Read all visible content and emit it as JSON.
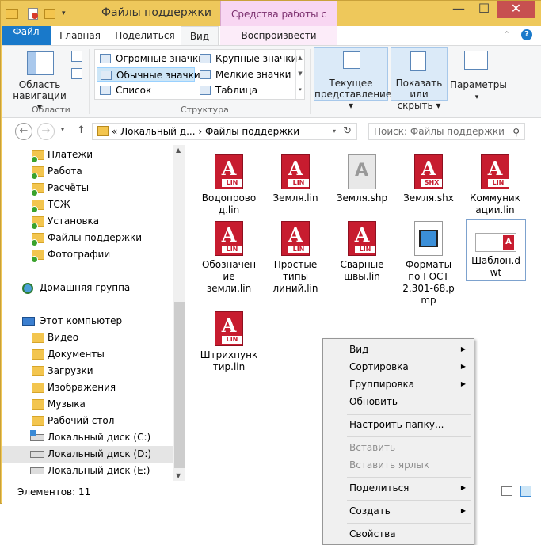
{
  "window": {
    "title": "Файлы поддержки",
    "context_tab_title": "Средства работы с видео",
    "controls": {
      "minimize": "—",
      "maximize": "☐",
      "close": "✕"
    }
  },
  "ribbon_tabs": [
    "Файл",
    "Главная",
    "Поделиться",
    "Вид",
    "Воспроизвести"
  ],
  "ribbon": {
    "areas": {
      "nav_pane": "Область навигации ▾",
      "group": "Области"
    },
    "layout": {
      "items": [
        "Огромные значки",
        "Крупные значки",
        "Обычные значки",
        "Мелкие значки",
        "Список",
        "Таблица"
      ],
      "group": "Структура"
    },
    "current_view": "Текущее представление ▾",
    "show_hide": "Показать или скрыть ▾",
    "options": "Параметры"
  },
  "address": {
    "path": "«  Локальный д...  ›  Файлы поддержки",
    "search_placeholder": "Поиск: Файлы поддержки"
  },
  "nav": {
    "favorites": [
      "Платежи",
      "Работа",
      "Расчёты",
      "ТСЖ",
      "Установка",
      "Файлы поддержки",
      "Фотографии"
    ],
    "homegroup": "Домашняя группа",
    "this_pc": "Этот компьютер",
    "pc_items": [
      "Видео",
      "Документы",
      "Загрузки",
      "Изображения",
      "Музыка",
      "Рабочий стол",
      "Локальный диск (C:)",
      "Локальный диск (D:)",
      "Локальный диск (E:)"
    ]
  },
  "files": [
    {
      "name": "Водопровод.lin",
      "tag": "LIN"
    },
    {
      "name": "Земля.lin",
      "tag": "LIN"
    },
    {
      "name": "Земля.shp",
      "tag": ""
    },
    {
      "name": "Земля.shx",
      "tag": "SHX"
    },
    {
      "name": "Коммуникации.lin",
      "tag": "LIN"
    },
    {
      "name": "Обозначение земли.lin",
      "tag": "LIN"
    },
    {
      "name": "Простые типы линий.lin",
      "tag": "LIN"
    },
    {
      "name": "Сварные швы.lin",
      "tag": "LIN"
    },
    {
      "name": "Форматы по ГОСТ 2.301-68.mp",
      "tag": ""
    },
    {
      "name": "Шаблон.dwt",
      "tag": ""
    },
    {
      "name": "Штрихпунктир.lin",
      "tag": "LIN"
    }
  ],
  "file_labels": {
    "f0": [
      "Водопрово",
      "д.lin"
    ],
    "f4": [
      "Коммуник",
      "ации.lin"
    ],
    "f5": [
      "Обозначен",
      "ие",
      "земли.lin"
    ],
    "f6": [
      "Простые",
      "типы",
      "линий.lin"
    ],
    "f7": [
      "Сварные",
      "швы.lin"
    ],
    "f8": [
      "Форматы",
      "по ГОСТ",
      "2.301-68.р",
      "mp"
    ],
    "f9": [
      "Шаблон.d",
      "wt"
    ],
    "f10": [
      "Штрихпунк",
      "тир.lin"
    ]
  },
  "status": {
    "items_count": "Элементов: 11"
  },
  "context_menu": {
    "items": [
      "Вид",
      "Сортировка",
      "Группировка",
      "Обновить",
      "Настроить папку...",
      "Вставить",
      "Вставить ярлык",
      "Поделиться",
      "Создать",
      "Свойства"
    ]
  },
  "colors": {
    "accent": "#1979ca",
    "title_bar": "#eec85b",
    "lin_icon": "#c71c2f"
  }
}
